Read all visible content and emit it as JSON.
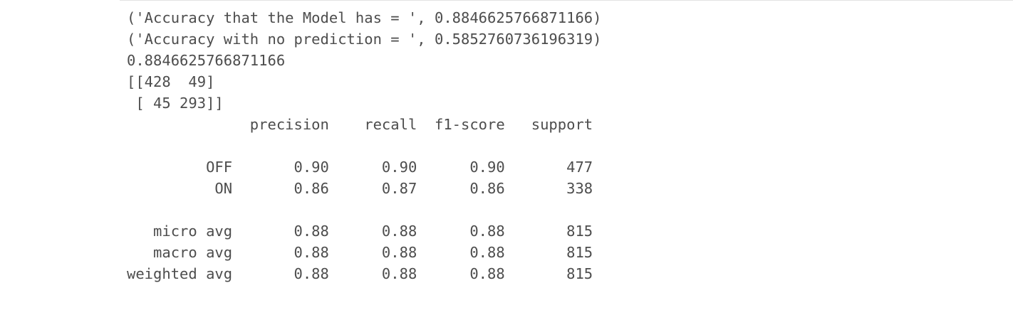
{
  "output": {
    "lines": [
      "('Accuracy that the Model has = ', 0.8846625766871166)",
      "('Accuracy with no prediction = ', 0.5852760736196319)",
      "0.8846625766871166",
      "[[428  49]",
      " [ 45 293]]",
      "              precision    recall  f1-score   support",
      "",
      "         OFF       0.90      0.90      0.90       477",
      "          ON       0.86      0.87      0.86       338",
      "",
      "   micro avg       0.88      0.88      0.88       815",
      "   macro avg       0.88      0.88      0.88       815",
      "weighted avg       0.88      0.88      0.88       815"
    ]
  }
}
